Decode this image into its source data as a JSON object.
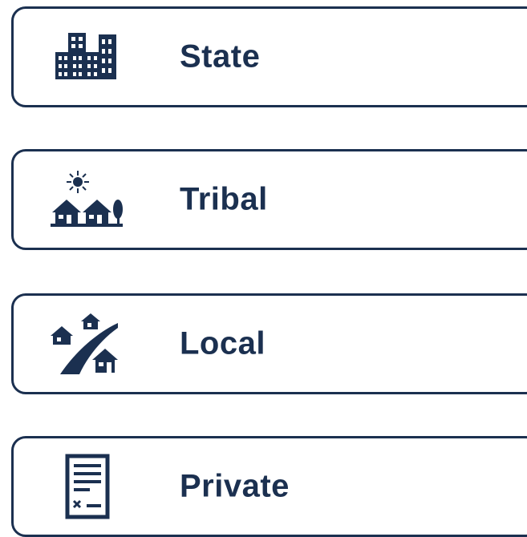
{
  "colors": {
    "primary": "#1b3050",
    "background": "#ffffff"
  },
  "options": [
    {
      "label": "State",
      "icon": "city-buildings-icon"
    },
    {
      "label": "Tribal",
      "icon": "houses-sun-tree-icon"
    },
    {
      "label": "Local",
      "icon": "road-houses-icon"
    },
    {
      "label": "Private",
      "icon": "document-signature-icon"
    }
  ]
}
